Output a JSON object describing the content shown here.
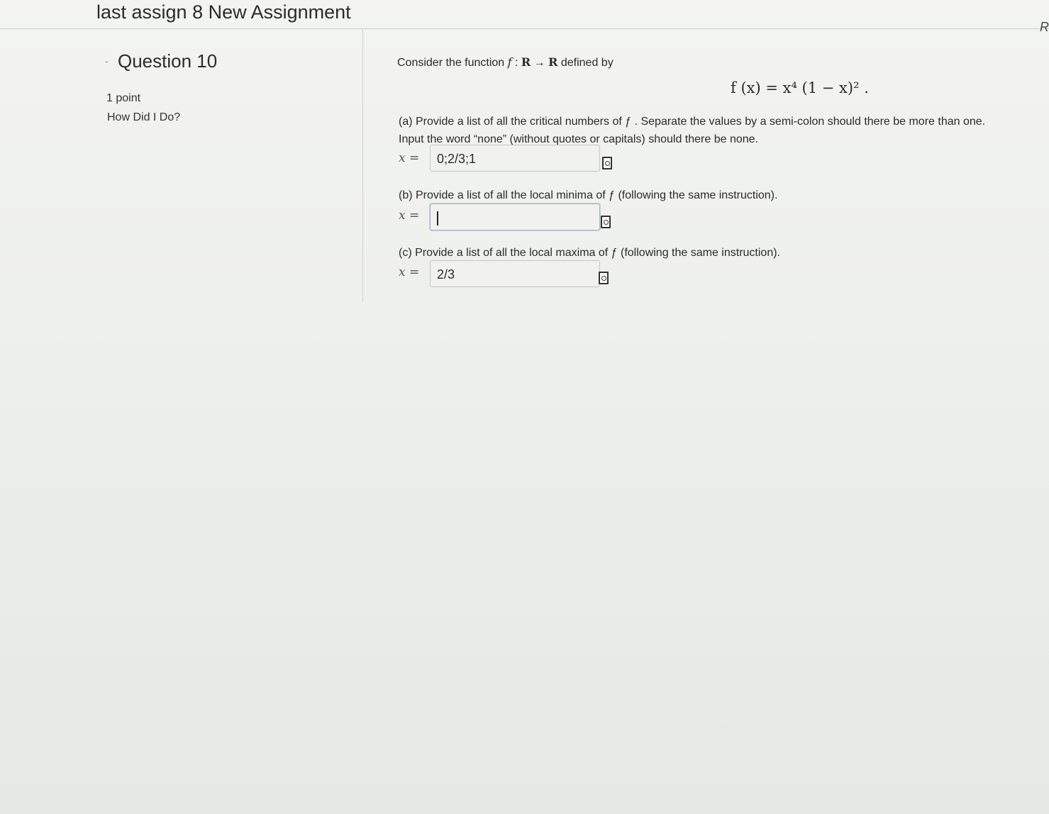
{
  "header": {
    "assignment_title": "last assign 8 New Assignment",
    "right_cut_text": "R"
  },
  "question": {
    "title": "Question 10",
    "points": "1 point",
    "how_did_i_do": "How Did I Do?"
  },
  "problem": {
    "intro_before": "Consider the function",
    "intro_f": "f",
    "intro_colon": " : ",
    "intro_domain": "R",
    "intro_arrow": " → ",
    "intro_codomain": "R",
    "intro_after": "defined by",
    "formula": "f (x) = x⁴ (1 − x)² ."
  },
  "parts": {
    "a": {
      "text_line1": "(a) Provide a list of all the critical numbers of ƒ . Separate the values by a semi-colon should there be more than one.",
      "text_line2": "Input the word “none” (without quotes or capitals) should there be none.",
      "label": "x =",
      "value": "0;2/3;1"
    },
    "b": {
      "text": "(b) Provide a list of all the local minima of ƒ  (following the same instruction).",
      "label": "x =",
      "value": ""
    },
    "c": {
      "text": "(c) Provide a list of all the local maxima of ƒ  (following the same instruction).",
      "label": "x =",
      "value": "2/3"
    }
  },
  "icons": {
    "preview": "preview-icon",
    "bullet": "collapse-bullet-icon"
  }
}
